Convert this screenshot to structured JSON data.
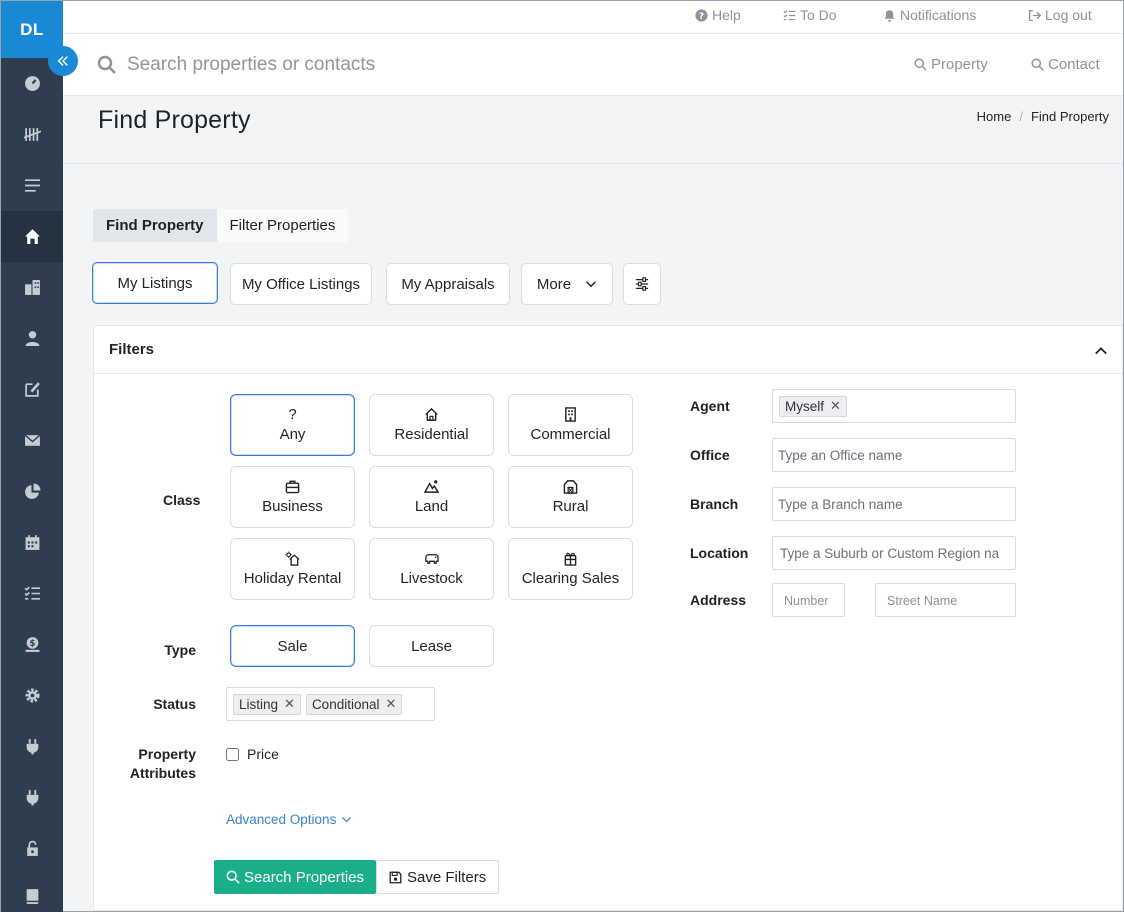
{
  "sidebar": {
    "logo": "DL",
    "icons": [
      "dashboard-icon",
      "tally-icon",
      "menu-icon",
      "home-icon",
      "buildings-icon",
      "person-icon",
      "edit-icon",
      "envelope-icon",
      "pie-chart-icon",
      "calendar-icon",
      "checklist-icon",
      "money-icon",
      "gear-icon",
      "plug-icon",
      "plug-icon-2",
      "lock-icon",
      "book-icon"
    ]
  },
  "topbar": {
    "help": "Help",
    "todo": "To Do",
    "notifications": "Notifications",
    "logout": "Log out"
  },
  "search": {
    "placeholder": "Search properties or contacts",
    "property_label": "Property",
    "contact_label": "Contact"
  },
  "header": {
    "title": "Find Property",
    "breadcrumb": [
      "Home",
      "/",
      "Find Property"
    ]
  },
  "tabs": [
    "Find Property",
    "Filter Properties"
  ],
  "listing_pills": [
    "My Listings",
    "My Office Listings",
    "My Appraisals",
    "More"
  ],
  "filters": {
    "title": "Filters",
    "class_label": "Class",
    "classes": [
      {
        "label": "Any",
        "icon": "question-icon",
        "selected": true
      },
      {
        "label": "Residential",
        "icon": "house-icon",
        "selected": false
      },
      {
        "label": "Commercial",
        "icon": "building-icon",
        "selected": false
      },
      {
        "label": "Business",
        "icon": "briefcase-icon",
        "selected": false
      },
      {
        "label": "Land",
        "icon": "mountain-icon",
        "selected": false
      },
      {
        "label": "Rural",
        "icon": "barn-icon",
        "selected": false
      },
      {
        "label": "Holiday Rental",
        "icon": "holiday-house-icon",
        "selected": false
      },
      {
        "label": "Livestock",
        "icon": "cow-icon",
        "selected": false
      },
      {
        "label": "Clearing Sales",
        "icon": "gift-icon",
        "selected": false
      }
    ],
    "type_label": "Type",
    "types": [
      {
        "label": "Sale",
        "selected": true
      },
      {
        "label": "Lease",
        "selected": false
      }
    ],
    "status_label": "Status",
    "status_tags": [
      "Listing",
      "Conditional"
    ],
    "attributes_label_1": "Property",
    "attributes_label_2": "Attributes",
    "price_label": "Price",
    "advanced_options": "Advanced Options",
    "agent_label": "Agent",
    "agent_tag": "Myself",
    "office_label": "Office",
    "office_placeholder": "Type an Office name",
    "branch_label": "Branch",
    "branch_placeholder": "Type a Branch name",
    "location_label": "Location",
    "location_placeholder": "Type a Suburb or Custom Region na",
    "address_label": "Address",
    "number_placeholder": "Number",
    "street_placeholder": "Street Name",
    "search_button": "Search Properties",
    "save_button": "Save Filters"
  },
  "colors": {
    "sidebar": "#2f3e4f",
    "brand_blue": "#1a89d6",
    "primary_green": "#1aae8a",
    "selected_border": "#3a7bd5"
  }
}
